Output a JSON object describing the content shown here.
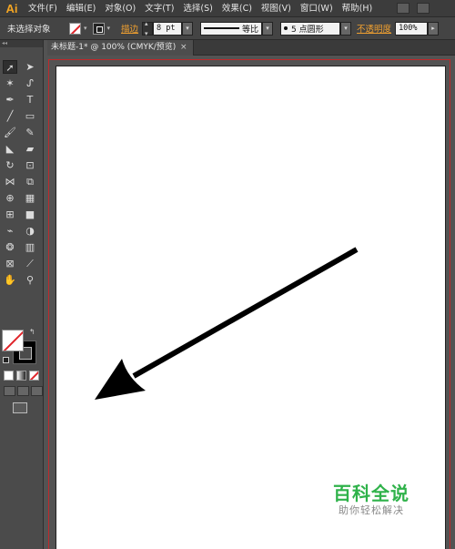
{
  "app": {
    "logo": "Ai"
  },
  "menu": [
    "文件(F)",
    "编辑(E)",
    "对象(O)",
    "文字(T)",
    "选择(S)",
    "效果(C)",
    "视图(V)",
    "窗口(W)",
    "帮助(H)"
  ],
  "control_bar": {
    "selection_label": "未选择对象",
    "stroke_label": "描边",
    "stroke_weight": "8 pt",
    "stroke_profile": "等比",
    "brush": "5 点圆形",
    "opacity_label": "不透明度",
    "opacity_value": "100%"
  },
  "document_tab": {
    "title": "未标题-1* @ 100% (CMYK/预览)",
    "close": "×"
  },
  "tools": {
    "selection": "selection-icon",
    "direct_selection": "direct-selection-icon",
    "fill_color": "#ffffff",
    "stroke_color": "#000000",
    "none_slash_color": "#e0242a"
  },
  "canvas": {
    "shape": "arrow",
    "arrow_color": "#000000"
  },
  "watermark": {
    "title": "百科全说",
    "subtitle": "助你轻松解决",
    "color": "#2fb24a"
  }
}
